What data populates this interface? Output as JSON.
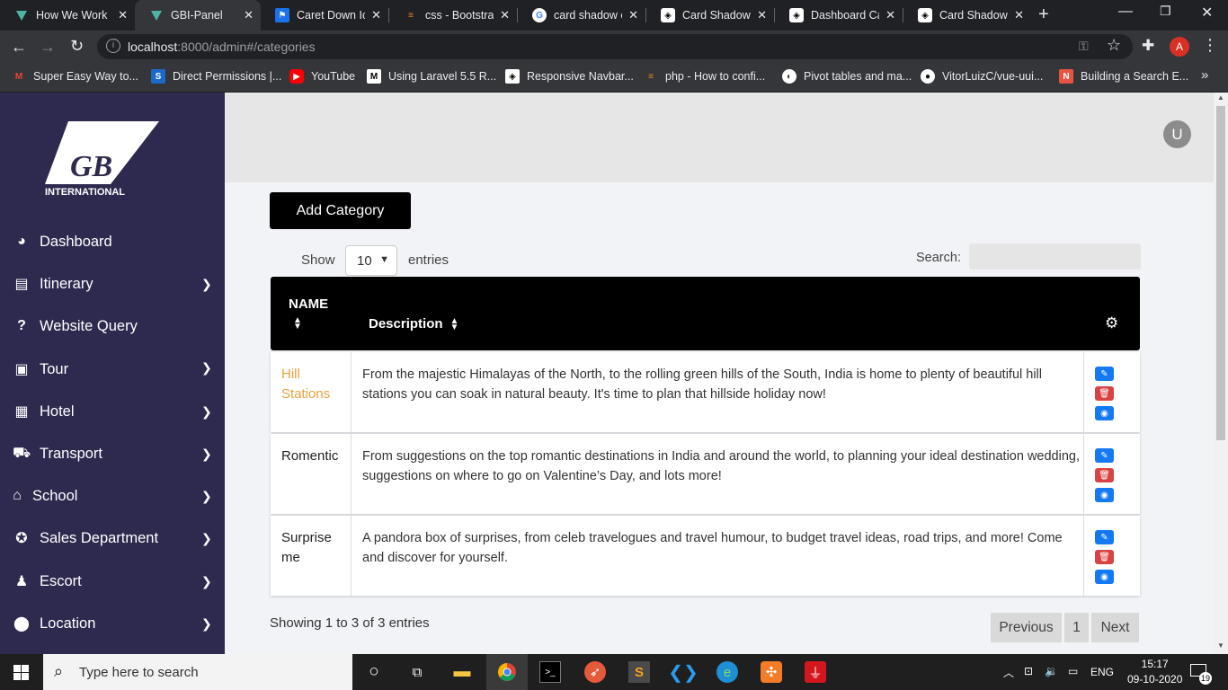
{
  "browser": {
    "tabs": [
      {
        "title": "How We Work",
        "icon": "app-logo-icon",
        "active": false
      },
      {
        "title": "GBI-Panel",
        "icon": "app-logo-icon",
        "active": true
      },
      {
        "title": "Caret Down Ic",
        "icon": "flag-icon",
        "active": false
      },
      {
        "title": "css - Bootstrap",
        "icon": "stackoverflow-icon",
        "active": false
      },
      {
        "title": "card shadow c",
        "icon": "google-icon",
        "active": false
      },
      {
        "title": "Card Shadow",
        "icon": "codepen-icon",
        "active": false
      },
      {
        "title": "Dashboard Ca",
        "icon": "codepen-icon",
        "active": false
      },
      {
        "title": "Card Shadow",
        "icon": "codepen-icon",
        "active": false
      }
    ],
    "url_host": "localhost",
    "url_rest": ":8000/admin#/categories",
    "profile_initial": "A",
    "bookmarks": [
      {
        "label": "Super Easy Way to...",
        "icon": "gmail-icon"
      },
      {
        "label": "Direct Permissions |...",
        "icon": "s-icon"
      },
      {
        "label": "YouTube",
        "icon": "youtube-icon"
      },
      {
        "label": "Using Laravel 5.5 R...",
        "icon": "medium-icon"
      },
      {
        "label": "Responsive Navbar...",
        "icon": "codepen-icon"
      },
      {
        "label": "php - How to confi...",
        "icon": "stackoverflow-icon"
      },
      {
        "label": "Pivot tables and ma...",
        "icon": "globe-icon"
      },
      {
        "label": "VitorLuizC/vue-uui...",
        "icon": "github-icon"
      },
      {
        "label": "Building a Search E...",
        "icon": "ln-icon"
      }
    ]
  },
  "logo": {
    "main": "GB",
    "sub": "INTERNATIONAL"
  },
  "sidebar": {
    "items": [
      {
        "label": "Dashboard",
        "icon": "dashboard-icon",
        "has_submenu": false
      },
      {
        "label": "Itinerary",
        "icon": "file-icon",
        "has_submenu": true
      },
      {
        "label": "Website Query",
        "icon": "question-icon",
        "has_submenu": false
      },
      {
        "label": "Tour",
        "icon": "bus-icon",
        "has_submenu": true
      },
      {
        "label": "Hotel",
        "icon": "building-icon",
        "has_submenu": true
      },
      {
        "label": "Transport",
        "icon": "car-icon",
        "has_submenu": true
      },
      {
        "label": "School",
        "icon": "school-icon",
        "has_submenu": true
      },
      {
        "label": "Sales Department",
        "icon": "compass-icon",
        "has_submenu": true
      },
      {
        "label": "Escort",
        "icon": "person-icon",
        "has_submenu": true
      },
      {
        "label": "Location",
        "icon": "map-marker-icon",
        "has_submenu": true
      }
    ]
  },
  "header": {
    "avatar_initial": "U"
  },
  "page": {
    "add_button": "Add Category",
    "show_label": "Show",
    "entries_value": "10",
    "entries_label": "entries",
    "search_label": "Search:",
    "columns": {
      "name": "NAME",
      "description": "Description"
    },
    "rows": [
      {
        "name": "Hill Stations",
        "description": "From the majestic Himalayas of the North, to the rolling green hills of the South, India is home to plenty of beautiful hill stations you can soak in natural beauty. It's time to plan that hillside holiday now!",
        "highlight": true
      },
      {
        "name": "Romentic",
        "description": "From suggestions on the top romantic destinations in India and around the world, to planning your ideal destination wedding, suggestions on where to go on Valentine’s Day, and lots more!",
        "highlight": false
      },
      {
        "name": "Surprise me",
        "description": "A pandora box of surprises, from celeb travelogues and travel humour, to budget travel ideas, road trips, and more! Come and discover for yourself.",
        "highlight": false
      }
    ],
    "showing_text": "Showing 1 to 3 of 3 entries",
    "pagination": {
      "previous": "Previous",
      "current": "1",
      "next": "Next"
    }
  },
  "taskbar": {
    "search_placeholder": "Type here to search",
    "lang": "ENG",
    "time": "15:17",
    "date": "09-10-2020",
    "notifications": "19"
  },
  "colors": {
    "sidebar_bg": "#2e2a4f",
    "highlight_text": "#e8a33d",
    "edit_button": "#1479f2",
    "delete_button": "#d94343"
  }
}
